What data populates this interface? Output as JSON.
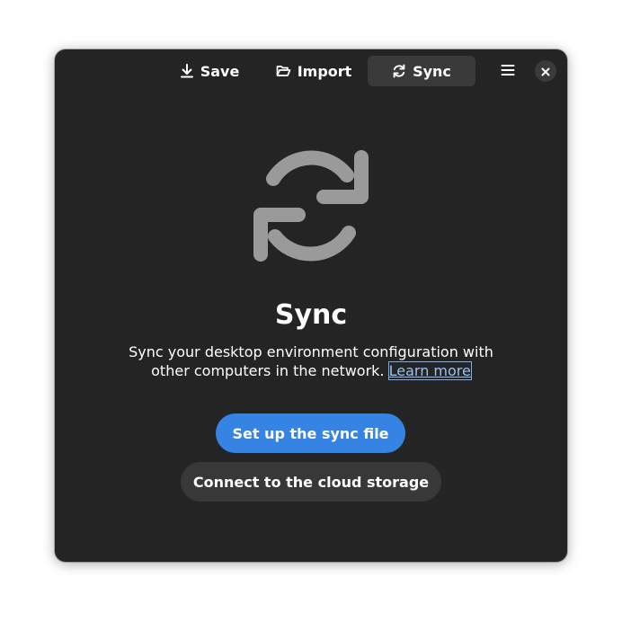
{
  "headerbar": {
    "tabs": [
      {
        "label": "Save",
        "icon": "download-icon"
      },
      {
        "label": "Import",
        "icon": "folder-open-icon"
      },
      {
        "label": "Sync",
        "icon": "sync-icon",
        "active": true
      }
    ],
    "menu_icon": "hamburger-menu-icon",
    "close_icon": "close-icon"
  },
  "status_page": {
    "icon": "sync-icon",
    "title": "Sync",
    "description": "Sync your desktop environment configuration with other computers in the network.",
    "link_label": "Learn more"
  },
  "actions": {
    "primary_label": "Set up the sync file",
    "secondary_label": "Connect to the cloud storage"
  },
  "colors": {
    "window_bg": "#242424",
    "accent": "#3584e4",
    "link": "#99c1f1",
    "icon_gray": "#9a9a9a"
  }
}
